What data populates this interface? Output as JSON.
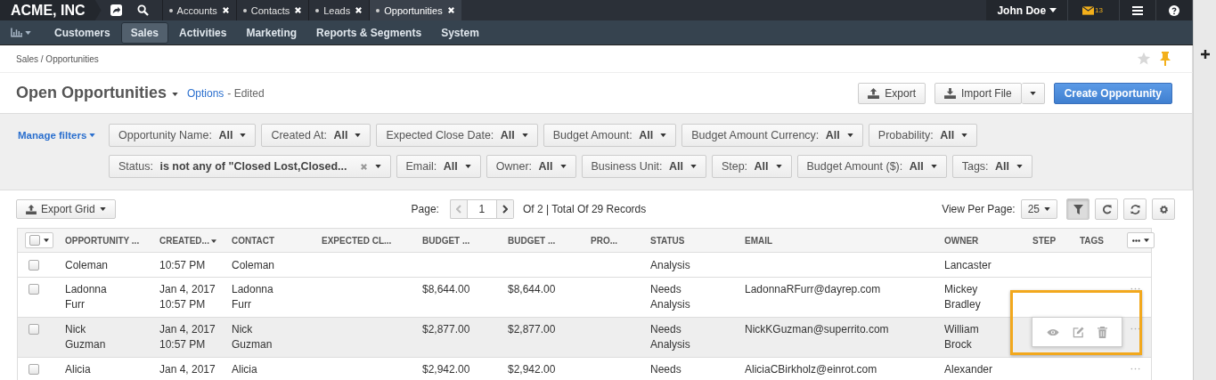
{
  "topbar": {
    "logo": "ACME, INC",
    "tabs": [
      {
        "label": "Accounts",
        "selected": false
      },
      {
        "label": "Contacts",
        "selected": false
      },
      {
        "label": "Leads",
        "selected": false
      },
      {
        "label": "Opportunities",
        "selected": true
      }
    ],
    "user": "John Doe",
    "mail_count": "13"
  },
  "nav": {
    "items": [
      {
        "label": "Customers",
        "selected": false
      },
      {
        "label": "Sales",
        "selected": true
      },
      {
        "label": "Activities",
        "selected": false
      },
      {
        "label": "Marketing",
        "selected": false
      },
      {
        "label": "Reports & Segments",
        "selected": false
      },
      {
        "label": "System",
        "selected": false
      }
    ]
  },
  "breadcrumb": "Sales / Opportunities",
  "page": {
    "title": "Open Opportunities",
    "options_link": "Options",
    "status": "- Edited",
    "export": "Export",
    "import": "Import File",
    "create": "Create Opportunity"
  },
  "filters": {
    "manage": "Manage filters",
    "items": [
      {
        "label": "Opportunity Name:",
        "value": "All",
        "clearable": false
      },
      {
        "label": "Created At:",
        "value": "All",
        "clearable": false
      },
      {
        "label": "Expected Close Date:",
        "value": "All",
        "clearable": false
      },
      {
        "label": "Budget Amount:",
        "value": "All",
        "clearable": false
      },
      {
        "label": "Budget Amount Currency:",
        "value": "All",
        "clearable": false
      },
      {
        "label": "Probability:",
        "value": "All",
        "clearable": false
      },
      {
        "label": "Status:",
        "value": "is not any of \"Closed Lost,Closed...",
        "clearable": true
      },
      {
        "label": "Email:",
        "value": "All",
        "clearable": false
      },
      {
        "label": "Owner:",
        "value": "All",
        "clearable": false
      },
      {
        "label": "Business Unit:",
        "value": "All",
        "clearable": false
      },
      {
        "label": "Step:",
        "value": "All",
        "clearable": false
      },
      {
        "label": "Budget Amount ($):",
        "value": "All",
        "clearable": false
      },
      {
        "label": "Tags:",
        "value": "All",
        "clearable": false
      }
    ]
  },
  "grid_toolbar": {
    "export_grid": "Export Grid",
    "page_label": "Page:",
    "page": "1",
    "total": "Of 2 | Total Of 29 Records",
    "per_page_label": "View Per Page:",
    "per_page": "25",
    "filter_toggle_active": true
  },
  "table": {
    "select_all_checked": false,
    "columns": [
      {
        "label": "OPPORTUNITY ...",
        "sorted": false
      },
      {
        "label": "CREATED...",
        "sorted": true
      },
      {
        "label": "CONTACT",
        "sorted": false
      },
      {
        "label": "EXPECTED CL...",
        "sorted": false
      },
      {
        "label": "BUDGET ...",
        "sorted": false
      },
      {
        "label": "BUDGET ...",
        "sorted": false
      },
      {
        "label": "PRO...",
        "sorted": false
      },
      {
        "label": "STATUS",
        "sorted": false
      },
      {
        "label": "EMAIL",
        "sorted": false
      },
      {
        "label": "OWNER",
        "sorted": false
      },
      {
        "label": "STEP",
        "sorted": false
      },
      {
        "label": "TAGS",
        "sorted": false
      }
    ],
    "rows": [
      {
        "checked": false,
        "highlighted": false,
        "actions_open": false,
        "more_icon": false,
        "cells": [
          "Coleman",
          "10:57 PM",
          "Coleman",
          null,
          null,
          null,
          null,
          "Analysis",
          null,
          "Lancaster",
          null,
          null
        ]
      },
      {
        "checked": false,
        "highlighted": false,
        "actions_open": false,
        "more_icon": true,
        "cells": [
          "Ladonna\nFurr",
          "Jan 4, 2017\n10:57 PM",
          "Ladonna\nFurr",
          null,
          "$8,644.00",
          "$8,644.00",
          null,
          "Needs\nAnalysis",
          "LadonnaRFurr@dayrep.com",
          "Mickey\nBradley",
          null,
          null
        ]
      },
      {
        "checked": false,
        "highlighted": true,
        "actions_open": true,
        "more_icon": true,
        "cells": [
          "Nick\nGuzman",
          "Jan 4, 2017\n10:57 PM",
          "Nick\nGuzman",
          null,
          "$2,877.00",
          "$2,877.00",
          null,
          "Needs\nAnalysis",
          "NickKGuzman@superrito.com",
          "William\nBrock",
          null,
          null
        ]
      },
      {
        "checked": false,
        "highlighted": false,
        "actions_open": false,
        "more_icon": true,
        "cells": [
          "Alicia",
          "Jan 4, 2017",
          "Alicia",
          null,
          "$2,942.00",
          "$2,942.00",
          null,
          "Needs",
          "AliciaCBirkholz@einrot.com",
          "Alexander",
          null,
          null
        ]
      }
    ]
  }
}
